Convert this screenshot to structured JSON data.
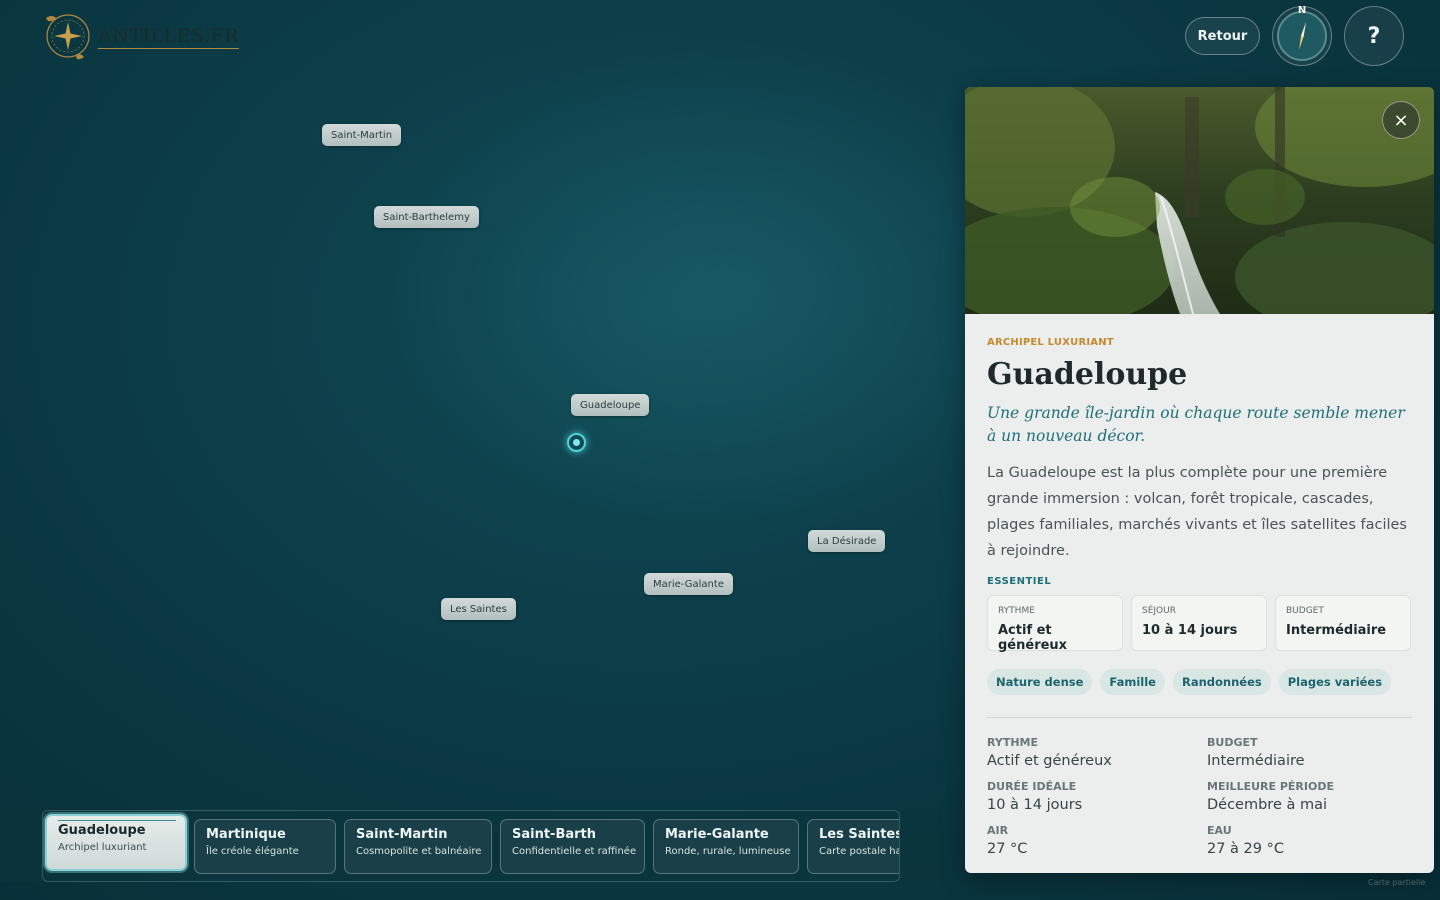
{
  "brand": {
    "name": "ANTILLES.FR"
  },
  "topbar": {
    "back_label": "Retour",
    "compass_label": "N",
    "help_label": "?"
  },
  "map": {
    "labels": [
      "Saint-Martin",
      "Saint-Barthelemy",
      "Guadeloupe",
      "La Désirade",
      "Marie-Galante",
      "Les Saintes"
    ],
    "watermark": "Carte partielle"
  },
  "strip": {
    "cards": [
      {
        "title": "Guadeloupe",
        "subtitle": "Archipel luxuriant"
      },
      {
        "title": "Martinique",
        "subtitle": "Île créole élégante"
      },
      {
        "title": "Saint-Martin",
        "subtitle": "Cosmopolite et balnéaire"
      },
      {
        "title": "Saint-Barth",
        "subtitle": "Confidentielle et raffinée"
      },
      {
        "title": "Marie-Galante",
        "subtitle": "Ronde, rurale, lumineuse"
      },
      {
        "title": "Les Saintes",
        "subtitle": "Carte postale ha"
      }
    ]
  },
  "panel": {
    "close_label": "×",
    "kicker": "ARCHIPEL LUXURIANT",
    "title": "Guadeloupe",
    "tagline": "Une grande île-jardin où chaque route semble mener à un nouveau décor.",
    "description": "La Guadeloupe est la plus complète pour une première grande immersion : volcan, forêt tropicale, cascades, plages familiales, marchés vivants et îles satellites faciles à rejoindre.",
    "essentials_label": "ESSENTIEL",
    "essentials": [
      {
        "key": "RYTHME",
        "value": "Actif et généreux"
      },
      {
        "key": "SÉJOUR",
        "value": "10 à 14 jours"
      },
      {
        "key": "BUDGET",
        "value": "Intermédiaire"
      }
    ],
    "tags": [
      "Nature dense",
      "Famille",
      "Randonnées",
      "Plages variées"
    ],
    "facts": [
      {
        "key": "RYTHME",
        "value": "Actif et généreux"
      },
      {
        "key": "BUDGET",
        "value": "Intermédiaire"
      },
      {
        "key": "DURÉE IDÉALE",
        "value": "10 à 14 jours"
      },
      {
        "key": "MEILLEURE PÉRIODE",
        "value": "Décembre à mai"
      },
      {
        "key": "AIR",
        "value": "27 °C"
      },
      {
        "key": "EAU",
        "value": "27 à 29 °C"
      }
    ]
  },
  "colors": {
    "sea": "#0d3f4a",
    "accent": "#1e6f7a",
    "gold": "#c48a2e",
    "panel": "#ebeeec"
  }
}
